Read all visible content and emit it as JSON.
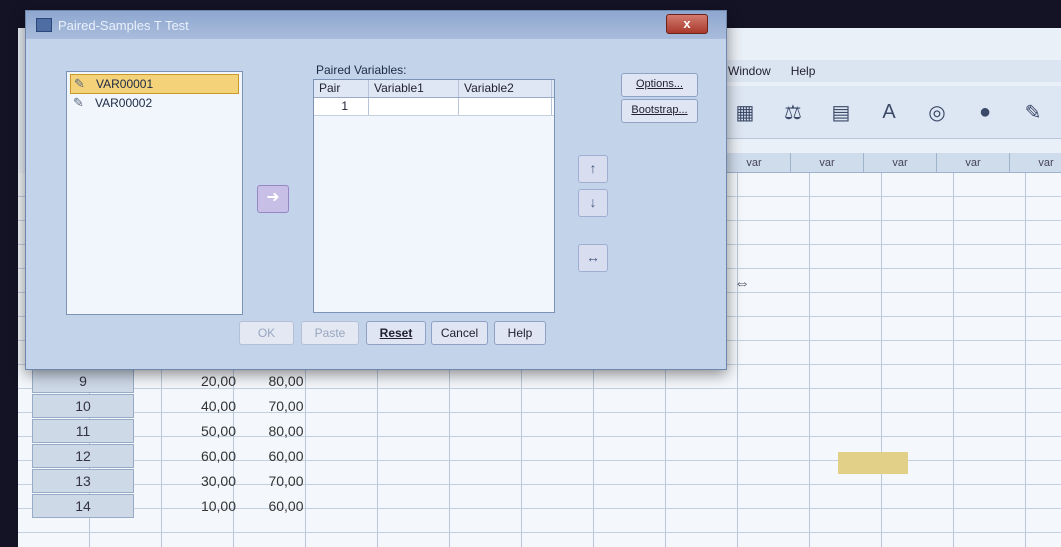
{
  "dialog": {
    "title": "Paired-Samples T Test",
    "close_label": "x",
    "source_variables": [
      "VAR00001",
      "VAR00002"
    ],
    "paired_label": "Paired Variables:",
    "table_headers": [
      "Pair",
      "Variable1",
      "Variable2"
    ],
    "pairs": [
      {
        "pair": "1",
        "var1": "",
        "var2": ""
      }
    ],
    "buttons": {
      "options": "Options...",
      "bootstrap": "Bootstrap...",
      "ok": "OK",
      "paste": "Paste",
      "reset": "Reset",
      "cancel": "Cancel",
      "help": "Help"
    },
    "icons": {
      "move": "➜",
      "up": "↑",
      "down": "↓",
      "swap": "↔"
    }
  },
  "menubar": {
    "window": "Window",
    "help": "Help"
  },
  "toolbar_icons": [
    "grid-icon",
    "scale-icon",
    "table-icon",
    "value-labels-icon",
    "venn-icon",
    "circles-icon",
    "abc-icon"
  ],
  "column_header_label": "var",
  "data_rows": [
    {
      "num": "9",
      "v1": "20,00",
      "v2": "80,00"
    },
    {
      "num": "10",
      "v1": "40,00",
      "v2": "70,00"
    },
    {
      "num": "11",
      "v1": "50,00",
      "v2": "80,00"
    },
    {
      "num": "12",
      "v1": "60,00",
      "v2": "60,00"
    },
    {
      "num": "13",
      "v1": "30,00",
      "v2": "70,00"
    },
    {
      "num": "14",
      "v1": "10,00",
      "v2": "60,00"
    }
  ]
}
